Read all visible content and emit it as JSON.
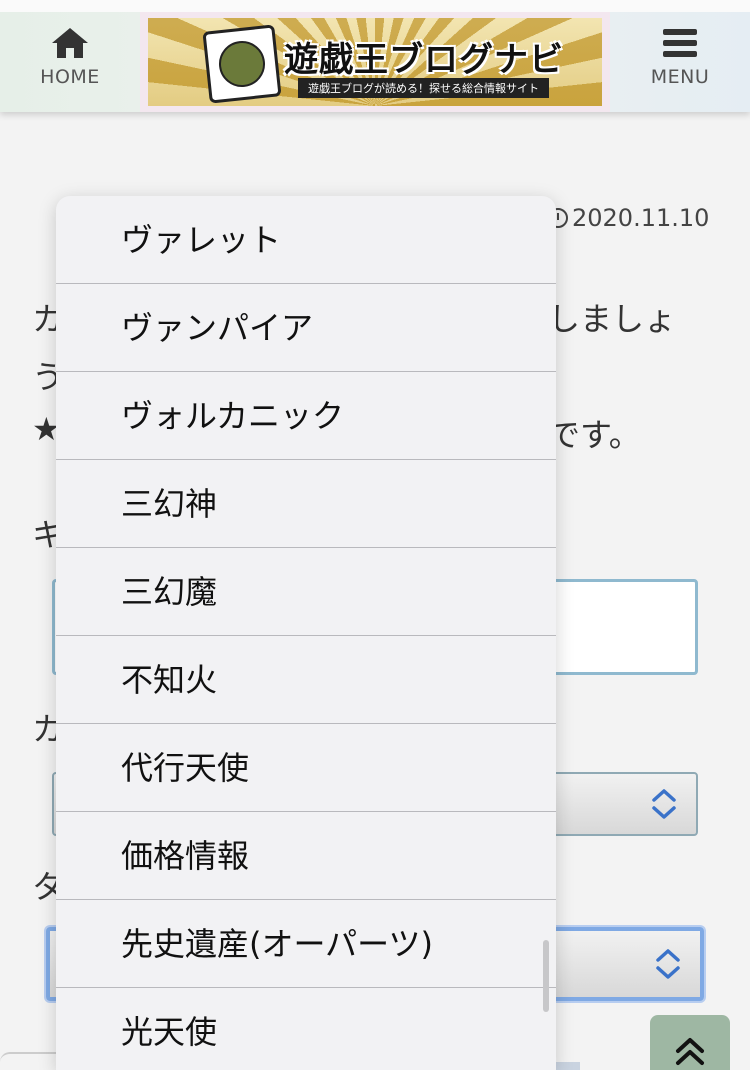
{
  "header": {
    "home_label": "HOME",
    "menu_label": "MENU",
    "banner_title": "遊戯王ブログナビ",
    "banner_subtitle": "遊戯王ブログが読める！探せる総合情報サイト"
  },
  "article": {
    "date": "2020.11.10",
    "text_fragments": [
      "カ",
      "しましょ",
      "う",
      "★",
      "です。"
    ],
    "labels": [
      "キ",
      "カ",
      "タ"
    ]
  },
  "picker": {
    "options": [
      "ヴァレット",
      "ヴァンパイア",
      "ヴォルカニック",
      "三幻神",
      "三幻魔",
      "不知火",
      "代行天使",
      "価格情報",
      "先史遺産(オーパーツ)",
      "光天使"
    ]
  },
  "colors": {
    "scroll_top_bg": "#9eb7a3",
    "focus_ring": "#7fa9e4",
    "picker_bg": "#f2f2f4"
  },
  "icons": {
    "home": "home-icon",
    "menu": "hamburger-icon",
    "scroll_top": "double-chevron-up-icon",
    "select": "updown-chevron-icon",
    "clock": "clock-icon"
  }
}
